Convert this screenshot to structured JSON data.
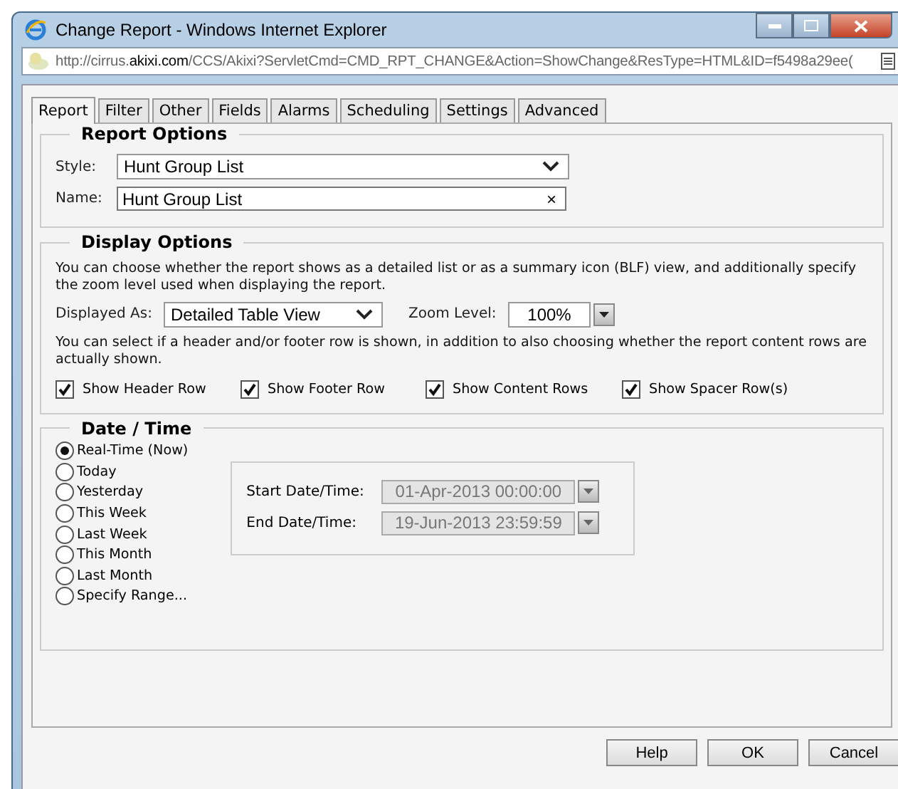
{
  "window": {
    "title": "Change Report - Windows Internet Explorer"
  },
  "address_bar": {
    "url": "http://cirrus.**akixi.com**/CCS/Akixi?ServletCmd=CMD_RPT_CHANGE&Action=ShowChange&ResType=HTML&ID=f5498a29ee("
  },
  "tabs": [
    {
      "label": "Report",
      "selected": true
    },
    {
      "label": "Filter",
      "selected": false
    },
    {
      "label": "Other",
      "selected": false
    },
    {
      "label": "Fields",
      "selected": false
    },
    {
      "label": "Alarms",
      "selected": false
    },
    {
      "label": "Scheduling",
      "selected": false
    },
    {
      "label": "Settings",
      "selected": false
    },
    {
      "label": "Advanced",
      "selected": false
    }
  ],
  "report_options": {
    "title": "Report Options",
    "style": {
      "label": "Style:",
      "value": "Hunt Group List"
    },
    "name": {
      "label": "Name:",
      "value": "Hunt Group List",
      "clear": "×"
    }
  },
  "display_options": {
    "title": "Display Options",
    "description": "You can choose whether the report shows as a detailed list or as a summary icon (BLF) view, and additionally specify the zoom level used when displaying the report.",
    "displayed_as": {
      "label": "Displayed As:",
      "value": "Detailed Table View"
    },
    "zoom_level": {
      "label": "Zoom Level:",
      "value": "100%"
    },
    "rows_description": "You can select if a header and/or footer row is shown, in addition to also choosing whether the report content rows are actually shown.",
    "checkboxes": [
      {
        "label": "Show Header Row",
        "checked": true
      },
      {
        "label": "Show Footer Row",
        "checked": true
      },
      {
        "label": "Show Content Rows",
        "checked": true
      },
      {
        "label": "Show Spacer Row(s)",
        "checked": true
      }
    ]
  },
  "date_time": {
    "title": "Date / Time",
    "options": [
      {
        "label": "Real-Time (Now)",
        "selected": true
      },
      {
        "label": "Today",
        "selected": false
      },
      {
        "label": "Yesterday",
        "selected": false
      },
      {
        "label": "This Week",
        "selected": false
      },
      {
        "label": "Last Week",
        "selected": false
      },
      {
        "label": "This Month",
        "selected": false
      },
      {
        "label": "Last Month",
        "selected": false
      },
      {
        "label": "Specify Range...",
        "selected": false
      }
    ],
    "start": {
      "label": "Start Date/Time:",
      "value": "01-Apr-2013 00:00:00",
      "disabled": true
    },
    "end": {
      "label": "End Date/Time:",
      "value": "19-Jun-2013 23:59:59",
      "disabled": true
    }
  },
  "buttons": [
    "Help",
    "OK",
    "Cancel"
  ]
}
